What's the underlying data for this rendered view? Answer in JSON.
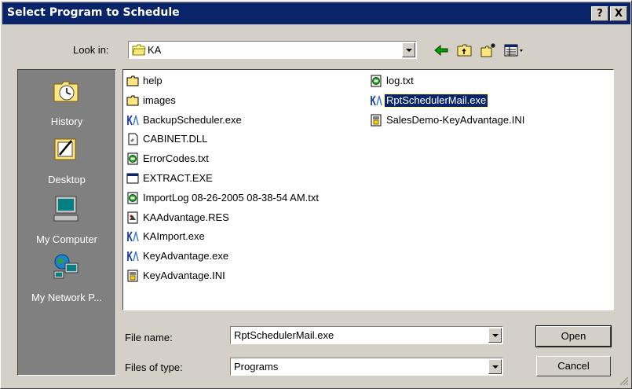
{
  "window": {
    "title": "Select Program to Schedule",
    "help_label": "?",
    "close_label": "X"
  },
  "lookin": {
    "label": "Look in:",
    "value": "KA"
  },
  "places": [
    {
      "label": "History",
      "icon": "history-icon"
    },
    {
      "label": "Desktop",
      "icon": "desktop-icon"
    },
    {
      "label": "My Computer",
      "icon": "my-computer-icon"
    },
    {
      "label": "My Network P...",
      "icon": "my-network-places-icon"
    }
  ],
  "files": [
    {
      "name": "help",
      "type": "folder"
    },
    {
      "name": "images",
      "type": "folder"
    },
    {
      "name": "BackupScheduler.exe",
      "type": "ka-exe"
    },
    {
      "name": "CABINET.DLL",
      "type": "dll"
    },
    {
      "name": "ErrorCodes.txt",
      "type": "txt"
    },
    {
      "name": "EXTRACT.EXE",
      "type": "exe"
    },
    {
      "name": "ImportLog 08-26-2005 08-38-54 AM.txt",
      "type": "txt"
    },
    {
      "name": "KAAdvantage.RES",
      "type": "res"
    },
    {
      "name": "KAImport.exe",
      "type": "ka-exe"
    },
    {
      "name": "KeyAdvantage.exe",
      "type": "ka-exe"
    },
    {
      "name": "KeyAdvantage.INI",
      "type": "ini"
    },
    {
      "name": "log.txt",
      "type": "txt"
    },
    {
      "name": "RptSchedulerMail.exe",
      "type": "ka-exe",
      "selected": true
    },
    {
      "name": "SalesDemo-KeyAdvantage.INI",
      "type": "ini"
    }
  ],
  "filename": {
    "label": "File name:",
    "value": "RptSchedulerMail.exe"
  },
  "filetype": {
    "label": "Files of type:",
    "value": "Programs"
  },
  "buttons": {
    "open": "Open",
    "cancel": "Cancel"
  },
  "colors": {
    "titlebar": "#0a246a",
    "face": "#d4d0c8",
    "places_bg": "#808080",
    "selection": "#0a246a"
  }
}
